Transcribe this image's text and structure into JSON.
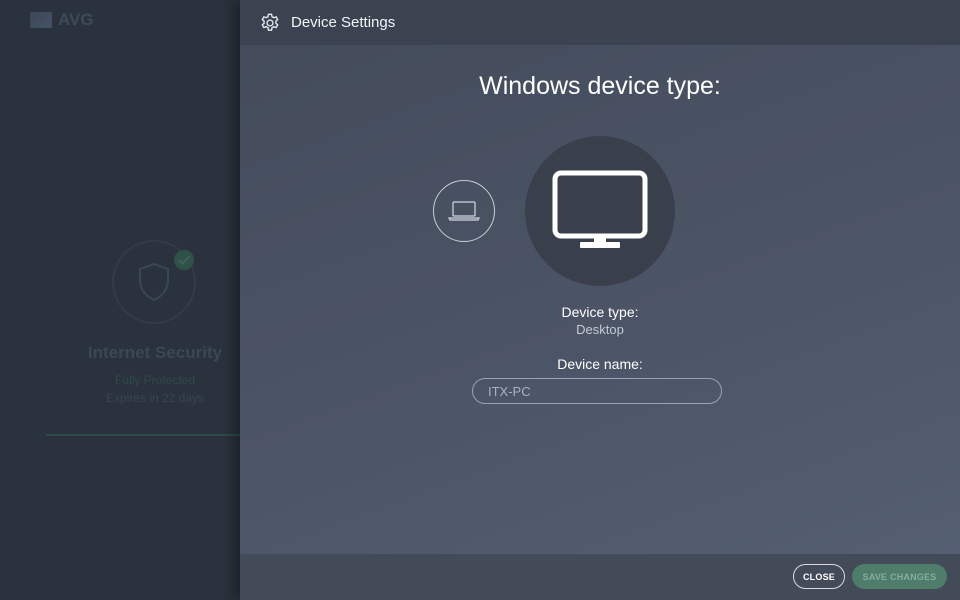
{
  "background_app": {
    "logo_text": "AVG",
    "product_name": "Internet Security",
    "status": "Fully Protected",
    "expiry": "Expires in 22 days"
  },
  "panel": {
    "title": "Device Settings",
    "heading": "Windows device type:",
    "device_options": [
      {
        "icon": "laptop-icon",
        "selected": false
      },
      {
        "icon": "desktop-monitor-icon",
        "selected": true
      }
    ],
    "device_type_label": "Device type:",
    "device_type_value": "Desktop",
    "device_name_label": "Device name:",
    "device_name_value": "ITX-PC"
  },
  "footer": {
    "close_label": "CLOSE",
    "save_label": "SAVE CHANGES"
  },
  "colors": {
    "accent_green": "#4e7d6a",
    "panel_header": "#3c4350"
  }
}
